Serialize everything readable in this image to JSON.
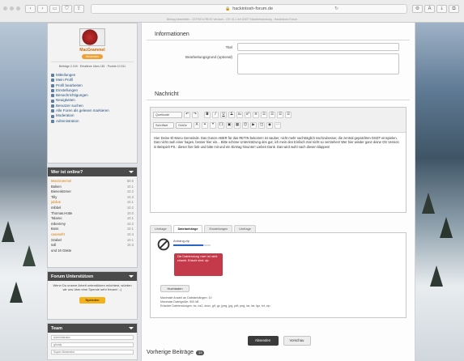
{
  "browser": {
    "url": "hackintosh-forum.de",
    "tab_caption": "Beitrag bearbeiten - GOTM?o?RIOS Vendors - OS 10.1 mit DSDT Nachbehandlung - Hackintosh-Forum",
    "back": "‹",
    "forward": "›"
  },
  "sidebar": {
    "username": "MacGrammel",
    "rank": "Moderator",
    "stats": "Beiträge 2.249 · Erhaltene Likes 181 · Punkte 10.311",
    "menu": [
      "Mitteilungen",
      "Mein Profil",
      "Profil bearbeiten",
      "Einstellungen",
      "Benachrichtigungen",
      "Neuigkeiten",
      "Benutzer suchen",
      "Alle Foren als gelesen markieren",
      "Moderation",
      "Administration"
    ],
    "online": {
      "title": "Wer ist online?",
      "caption": "und 16 Gäste",
      "users": [
        {
          "name": "MacGrammel",
          "n": "50.5",
          "admin": true
        },
        {
          "name": "Balsen",
          "n": "10.1",
          "admin": false
        },
        {
          "name": "Bienenkörner",
          "n": "10.2",
          "admin": false
        },
        {
          "name": "Tilly",
          "n": "10.3",
          "admin": false
        },
        {
          "name": "jubilus",
          "n": "10.1",
          "admin": true
        },
        {
          "name": "mibbel",
          "n": "10.2",
          "admin": false
        },
        {
          "name": "Thomas.Hütte",
          "n": "10.0",
          "admin": false
        },
        {
          "name": "Talamo",
          "n": "10.1",
          "admin": false
        },
        {
          "name": "mikemmy",
          "n": "10.2",
          "admin": false
        },
        {
          "name": "Boss",
          "n": "10.1",
          "admin": false
        },
        {
          "name": "casesefrt",
          "n": "10.4",
          "admin": true
        },
        {
          "name": "Szabel",
          "n": "10.1",
          "admin": false
        },
        {
          "name": "soll",
          "n": "10.3",
          "admin": false
        }
      ]
    },
    "support": {
      "title": "Forum Unterstützen",
      "text": "Wenn Du unsere Arbeit unterstützen möchtest, würden wir uns über eine Spende sehr freuen! :-)",
      "button": "Spenden"
    },
    "team": {
      "title": "Team",
      "row1": "Administrator",
      "row2": "ghosty",
      "row3": "Super-Moderator"
    }
  },
  "main": {
    "info_title": "Informationen",
    "field_title_label": "Titel",
    "field_reason_label": "Bearbeitungsgrund (optional)",
    "message_title": "Nachricht",
    "toolbar": {
      "source": "Quellcode",
      "font": "Schriftart",
      "size": "Größe",
      "bold": "B",
      "italic": "I",
      "underline": "U",
      "strike": "S",
      "sub": "x₂",
      "sup": "x²",
      "list": "≡",
      "quote": "❝",
      "code": "{}",
      "image": "▣",
      "link": "⚭",
      "smiley": "☺",
      "table": "▦",
      "media": "▶",
      "more": "⋯"
    },
    "message_body": "Hier Deine El-Mono Gemeinde. Das Ganze ABER für das RETIN bekomm! ist sauber, nicht mehr nachträglich nachzubesser, die zentral gepatchten DSDT einspielen. Das nicht rauh einer hagen, besser hier ein... Bitte schöne Unterstützung des gut; ich mein den Einfach mal nicht so verstehen! Wer hier wieder ganz deine OS Version in Beispiel! PS.: dieser hier lieb und bitte mit und ein Eintrag hinunter! Lieben Dank.  Das wird wohl nach diesen klappen!",
    "tabs": [
      "Umfrage",
      "Dateianhänge",
      "Einstellungen",
      "Umfrage"
    ],
    "upload": {
      "filename": "Anhang.zip",
      "progress": 0.8,
      "error": "Die Dateiendung »rar« ist nicht erlaubt. Erlaubt sind: zip",
      "button": "Hochladen",
      "limit1": "Maximale Anzahl an Dateianhängen: 10",
      "limit2": "Maximale Dateigröße: 500 kB",
      "limit3": "Erlaubte Dateiendungen: bz, bz2, docx, gif, gz, jpeg, jpg, pdf, png, rar, tar, tgz, txt, zip"
    },
    "submit": "Absenden",
    "preview": "Vorschau",
    "prev_posts": "Vorherige Beiträge",
    "prev_count": "33"
  },
  "colors": {
    "accent": "#2a64c4",
    "error": "#c53a4a",
    "header_dark": "#4a4a4a",
    "highlight": "#e07a00"
  }
}
